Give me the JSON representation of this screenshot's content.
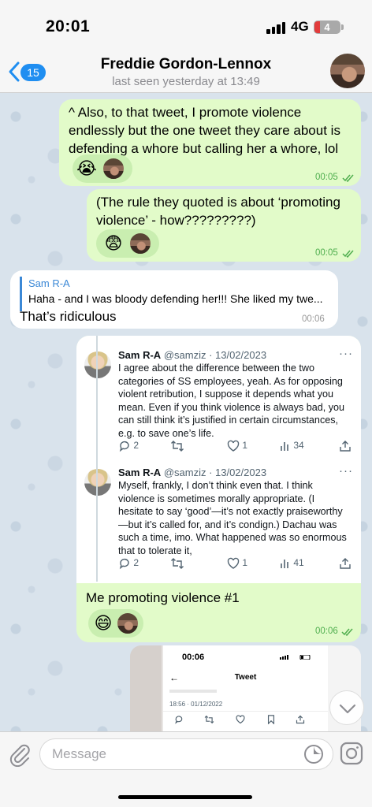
{
  "status_bar": {
    "time": "20:01",
    "network": "4G",
    "battery": "4"
  },
  "header": {
    "back_count": "15",
    "contact_name": "Freddie Gordon-Lennox",
    "last_seen": "last seen yesterday at 13:49"
  },
  "messages": [
    {
      "direction": "outgoing",
      "lines": [
        "^ Also, to that tweet, I promote violence",
        "endlessly but the one tweet they care about is",
        "defending a whore but calling her a whore, lol"
      ],
      "reaction_emoji": "😭",
      "time": "00:05",
      "status": "read"
    },
    {
      "direction": "outgoing",
      "lines": [
        "(The rule they quoted is about ‘promoting",
        "violence’ - how?????????)"
      ],
      "reaction_emoji": "😨",
      "time": "00:05",
      "status": "read"
    },
    {
      "direction": "incoming",
      "reply_to": {
        "name": "Sam R-A",
        "text": "Haha - and I was bloody defending her!!! She liked my twe..."
      },
      "text": "That’s ridiculous",
      "time": "00:06"
    },
    {
      "direction": "outgoing",
      "tweets": [
        {
          "name": "Sam R-A",
          "handle": "@samziz · 13/02/2023",
          "more": "···",
          "lines": [
            "I agree about the difference between the two",
            "categories of SS employees, yeah. As for opposing",
            "violent retribution, I suppose it depends what you",
            "mean. Even if you think violence is always bad, you",
            "can still think it’s justified in certain circumstances,",
            "e.g. to save one’s life."
          ],
          "replies": "2",
          "likes": "1",
          "views": "34"
        },
        {
          "name": "Sam R-A",
          "handle": "@samziz · 13/02/2023",
          "more": "···",
          "lines": [
            "Myself, frankly, I don’t think even that. I think",
            "violence is sometimes morally appropriate. (I",
            "hesitate to say ‘good’—it’s not exactly praiseworthy",
            "—but it’s called for, and it’s condign.) Dachau was",
            "such a time, imo. What happened was so enormous",
            "that to tolerate it,"
          ],
          "replies": "2",
          "likes": "1",
          "views": "41"
        }
      ],
      "caption": "Me promoting violence #1",
      "reaction_emoji": "😄",
      "time": "00:06",
      "status": "read"
    },
    {
      "direction": "outgoing",
      "screenshot": {
        "time": "00:06",
        "title": "Tweet",
        "faint_text": "3/5-03/0/1001",
        "date": "18:56 · 01/12/2022"
      }
    }
  ],
  "input": {
    "placeholder": "Message"
  },
  "icons": [
    "back-chevron-icon",
    "attach-icon",
    "sticker-icon",
    "camera-icon",
    "chevron-down-icon",
    "read-check-icon",
    "reply-icon",
    "retweet-icon",
    "like-icon",
    "views-icon",
    "share-icon"
  ],
  "colors": {
    "accent": "#1f8ef1",
    "outgoing_bubble": "#e2fbc9",
    "incoming_bubble": "#ffffff",
    "time_green": "#4fae4e",
    "reply_blue": "#3b88d6"
  }
}
